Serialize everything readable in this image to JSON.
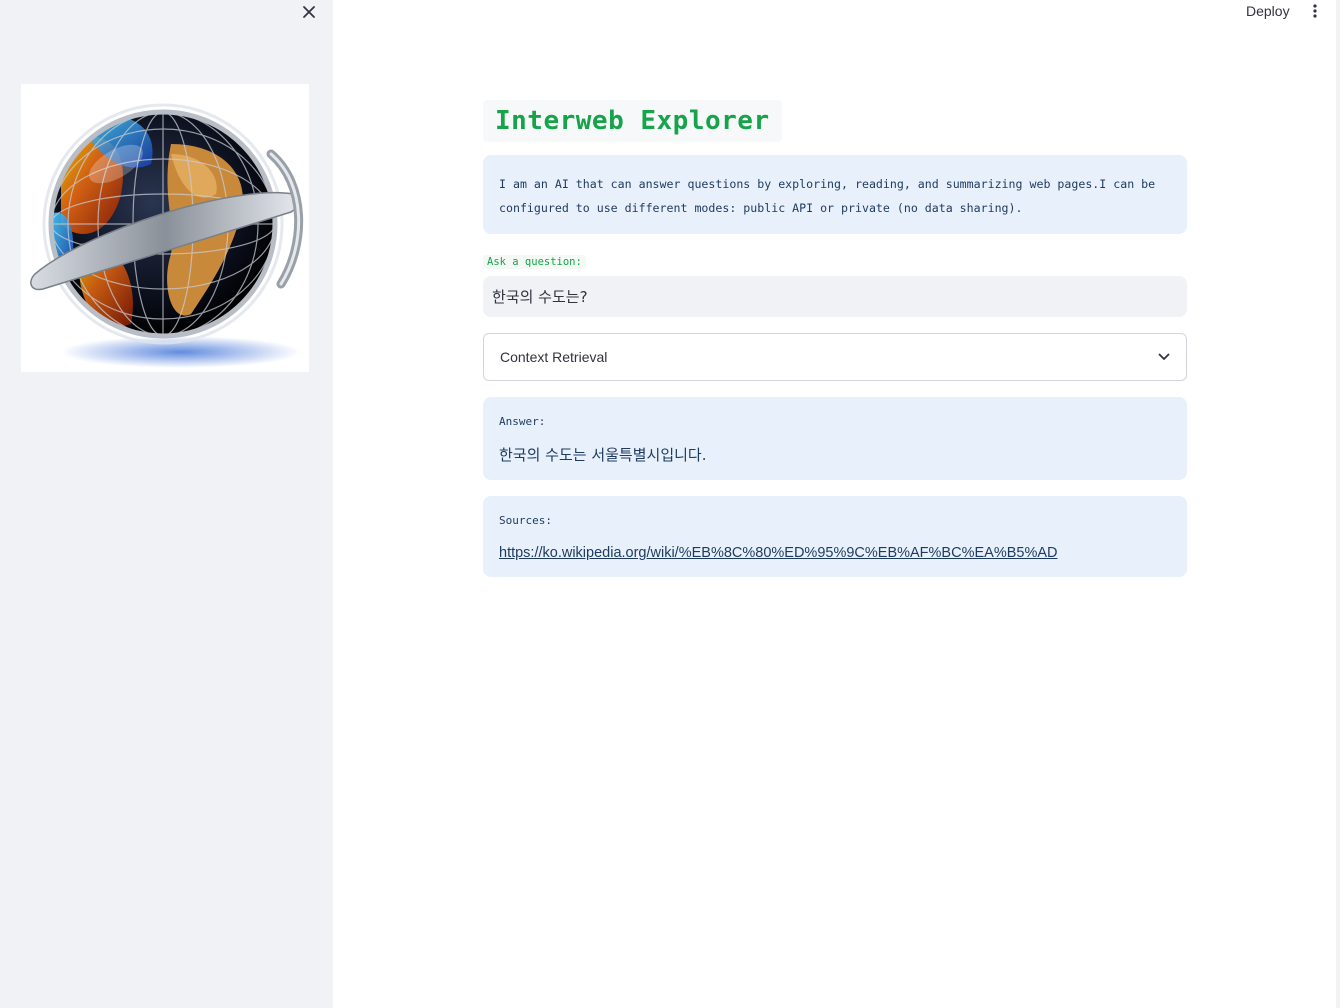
{
  "header": {
    "deploy_label": "Deploy",
    "menu_icon": "kebab-menu-icon"
  },
  "sidebar": {
    "close_icon": "close-icon",
    "logo": "globe-logo"
  },
  "main": {
    "title": "Interweb Explorer",
    "intro": "I am an AI that can answer questions by exploring, reading, and summarizing web pages.I can be configured to use different modes: public API or private (no data sharing).",
    "ask_label": "Ask a question:",
    "question_value": "한국의 수도는?",
    "expander_label": "Context Retrieval",
    "answer_label": "Answer:",
    "answer_text": "한국의 수도는 서울특별시입니다.",
    "sources_label": "Sources:",
    "source_url": "https://ko.wikipedia.org/wiki/%EB%8C%80%ED%95%9C%EB%AF%BC%EA%B5%AD"
  },
  "colors": {
    "title_green": "#16a34a",
    "info_blue_bg": "#e7f0fb",
    "sidebar_bg": "#f0f2f6",
    "text_dark_blue": "#1e3a5f"
  }
}
